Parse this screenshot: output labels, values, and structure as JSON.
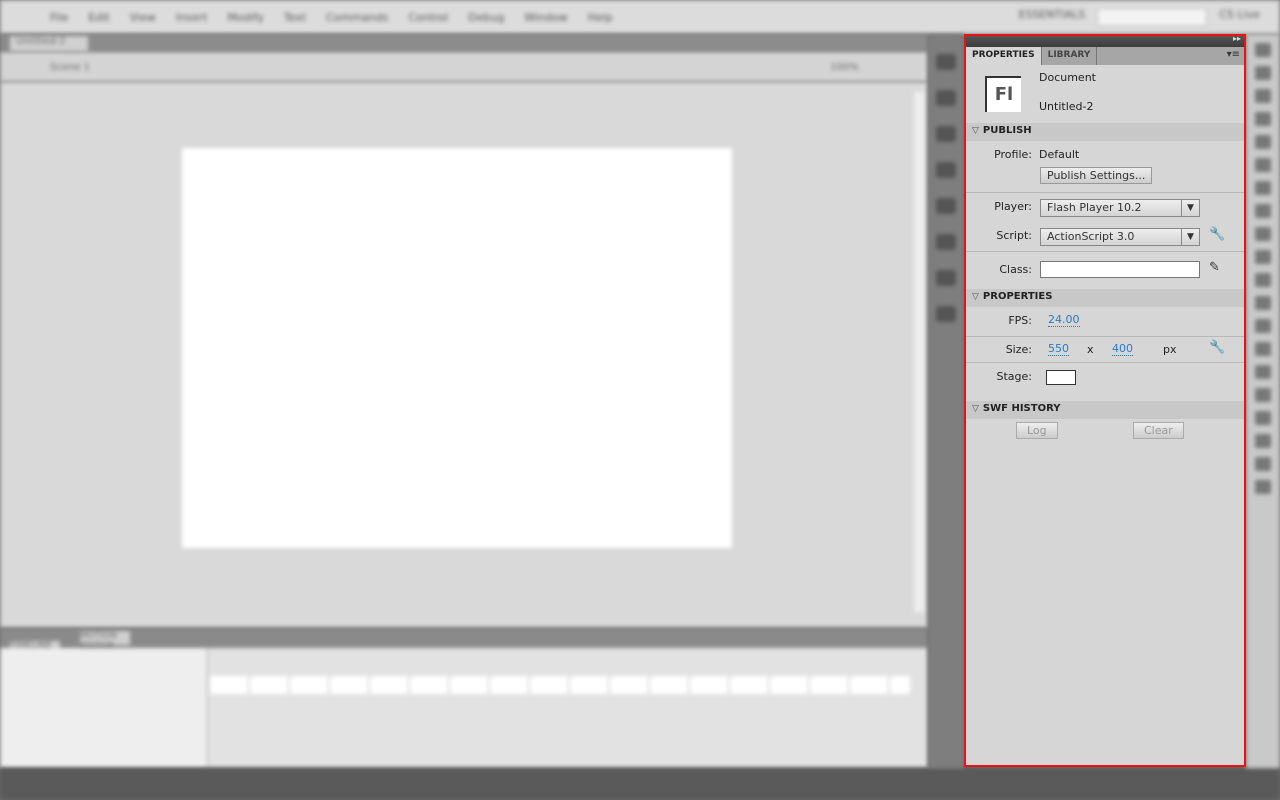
{
  "menubar": {
    "items": [
      "File",
      "Edit",
      "View",
      "Insert",
      "Modify",
      "Text",
      "Commands",
      "Control",
      "Debug",
      "Window",
      "Help"
    ],
    "workspace": "ESSENTIALS",
    "cs_live": "CS Live"
  },
  "document_tab": "Untitled-2",
  "editbar": {
    "scene": "Scene 1",
    "zoom": "100%"
  },
  "timeline": {
    "tabs": [
      "TIMELINE",
      "MOTION EDITOR"
    ]
  },
  "panel": {
    "tabs": [
      "PROPERTIES",
      "LIBRARY"
    ],
    "doc_type": "Document",
    "doc_name": "Untitled-2",
    "icon_text": "Fl",
    "publish": {
      "title": "PUBLISH",
      "profile_label": "Profile:",
      "profile_value": "Default",
      "settings_button": "Publish Settings...",
      "player_label": "Player:",
      "player_value": "Flash Player 10.2",
      "script_label": "Script:",
      "script_value": "ActionScript 3.0",
      "class_label": "Class:",
      "class_value": ""
    },
    "properties": {
      "title": "PROPERTIES",
      "fps_label": "FPS:",
      "fps": "24.00",
      "size_label": "Size:",
      "width": "550",
      "x": "x",
      "height": "400",
      "unit": "px",
      "stage_label": "Stage:",
      "stage_color": "#ffffff"
    },
    "swf_history": {
      "title": "SWF HISTORY",
      "log": "Log",
      "clear": "Clear"
    }
  }
}
